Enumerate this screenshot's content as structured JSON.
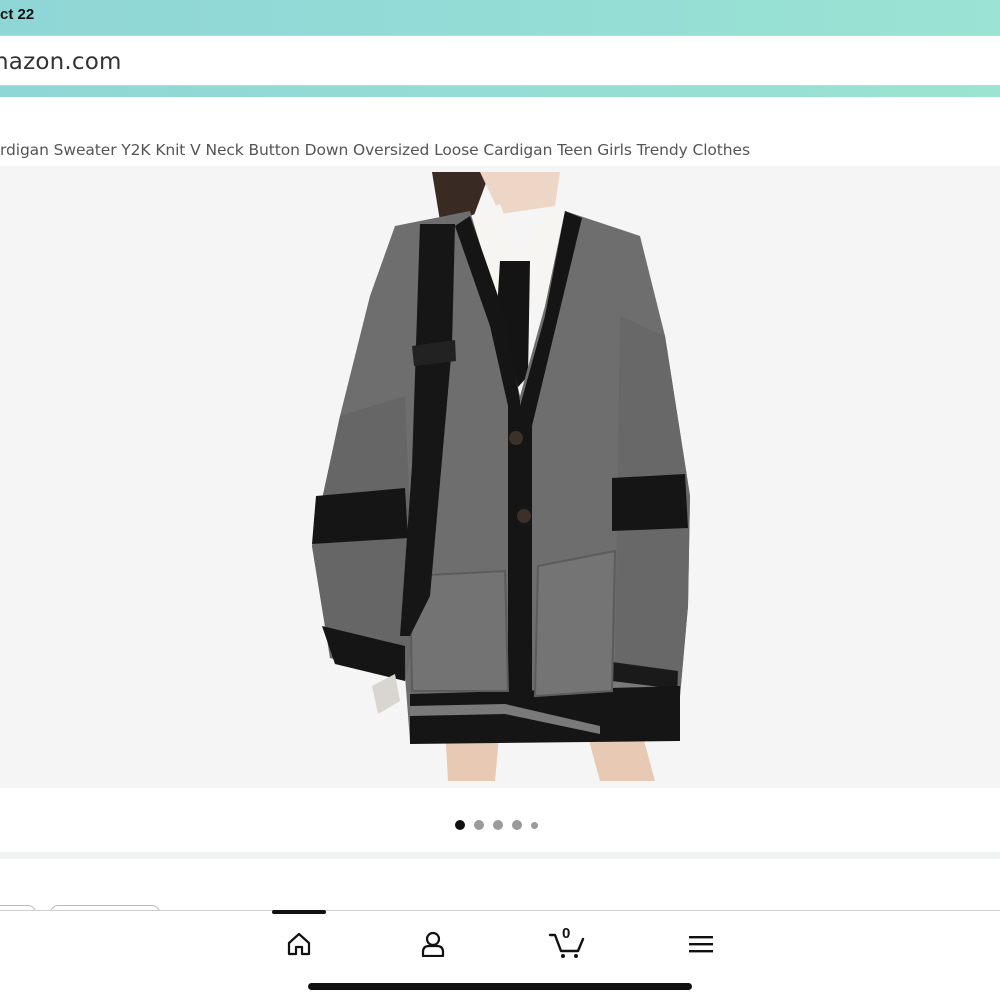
{
  "status_bar": {
    "time_fragment": "ct 22"
  },
  "browser": {
    "address_fragment": "nazon.com"
  },
  "product": {
    "title_fragment": "rdigan Sweater Y2K Knit V Neck Button Down Oversized Loose Cardigan Teen Girls Trendy Clothes"
  },
  "carousel": {
    "total_dots": 5,
    "active_index": 0
  },
  "bottom_nav": {
    "items": [
      {
        "icon": "home-icon"
      },
      {
        "icon": "account-icon"
      },
      {
        "icon": "cart-icon",
        "count": "0"
      },
      {
        "icon": "menu-icon"
      }
    ]
  },
  "colors": {
    "status_bar": "#93dcd6",
    "image_background": "#f5f5f5",
    "cardigan_gray": "#6e6e6e",
    "stripe_black": "#151515"
  }
}
